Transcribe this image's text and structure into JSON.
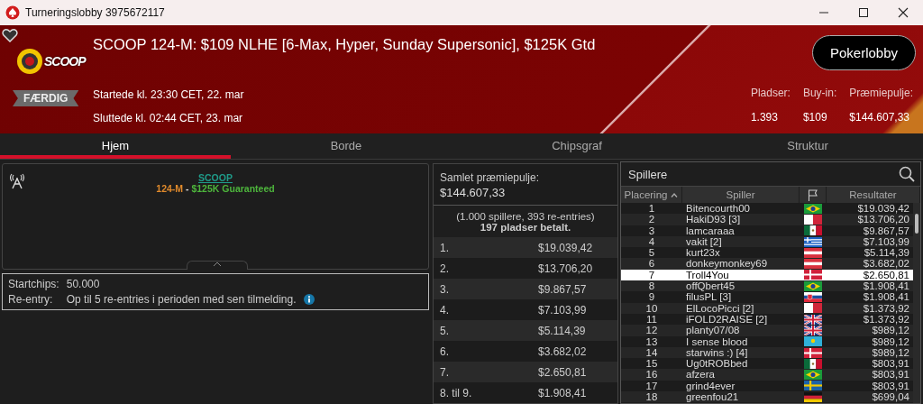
{
  "window": {
    "title": "Turneringslobby 3975672117"
  },
  "header": {
    "logo_text": "SCOOP",
    "status": "FÆRDIG",
    "title": "SCOOP 124-M: $109 NLHE [6-Max, Hyper, Sunday Supersonic], $125K Gtd",
    "started": "Startede kl. 23:30 CET, 22. mar",
    "ended": "Sluttede kl. 02:44 CET, 23. mar",
    "lobby_button": "Pokerlobby",
    "stats": [
      {
        "label": "Pladser:",
        "value": "1.393"
      },
      {
        "label": "Buy-in:",
        "value": "$109"
      },
      {
        "label": "Præmiepulje:",
        "value": "$144.607,33"
      }
    ]
  },
  "tabs": [
    {
      "label": "Hjem",
      "selected": true
    },
    {
      "label": "Borde",
      "selected": false
    },
    {
      "label": "Chipsgraf",
      "selected": false
    },
    {
      "label": "Struktur",
      "selected": false
    }
  ],
  "info": {
    "series_link": "SCOOP",
    "event_code": "124-M",
    "separator": "-",
    "guarantee": "$125K Guaranteed",
    "details": [
      {
        "label": "Startchips:",
        "value": "50.000",
        "info": false
      },
      {
        "label": "Re-entry:",
        "value": "Op til 5 re-entries i perioden med sen tilmelding.",
        "info": true
      }
    ]
  },
  "prizes": {
    "label": "Samlet præmiepulje:",
    "total": "$144.607,33",
    "entries": "(1.000 spillere, 393 re-entries)",
    "paid": "197 pladser betalt.",
    "rows": [
      {
        "place": "1.",
        "amount": "$19.039,42"
      },
      {
        "place": "2.",
        "amount": "$13.706,20"
      },
      {
        "place": "3.",
        "amount": "$9.867,57"
      },
      {
        "place": "4.",
        "amount": "$7.103,99"
      },
      {
        "place": "5.",
        "amount": "$5.114,39"
      },
      {
        "place": "6.",
        "amount": "$3.682,02"
      },
      {
        "place": "7.",
        "amount": "$2.650,81"
      },
      {
        "place": "8. til 9.",
        "amount": "$1.908,41"
      }
    ]
  },
  "players": {
    "title": "Spillere",
    "columns": [
      "Placering",
      "Spiller",
      "Resultater"
    ],
    "rows": [
      {
        "rank": "1",
        "name": "Bitencourth00",
        "kind": "br",
        "result": "$19.039,42",
        "selected": false
      },
      {
        "rank": "2",
        "name": "HakiD93 [3]",
        "kind": "mt",
        "result": "$13.706,20",
        "selected": false
      },
      {
        "rank": "3",
        "name": "lamcaraaa",
        "kind": "mx",
        "result": "$9.867,57",
        "selected": false
      },
      {
        "rank": "4",
        "name": "vakit [2]",
        "kind": "gr",
        "result": "$7.103,99",
        "selected": false
      },
      {
        "rank": "5",
        "name": "kurt23x",
        "kind": "at",
        "result": "$5.114,39",
        "selected": false
      },
      {
        "rank": "6",
        "name": "donkeymonkey69",
        "kind": "at",
        "result": "$3.682,02",
        "selected": false
      },
      {
        "rank": "7",
        "name": "Troll4You",
        "kind": "dk",
        "result": "$2.650,81",
        "selected": true
      },
      {
        "rank": "8",
        "name": "offQbert45",
        "kind": "br",
        "result": "$1.908,41",
        "selected": false
      },
      {
        "rank": "9",
        "name": "filusPL [3]",
        "kind": "sk",
        "result": "$1.908,41",
        "selected": false
      },
      {
        "rank": "10",
        "name": "ElLocoPicci [2]",
        "kind": "mt",
        "result": "$1.373,92",
        "selected": false
      },
      {
        "rank": "11",
        "name": "iFOLD2RAISE [2]",
        "kind": "gb",
        "result": "$1.373,92",
        "selected": false
      },
      {
        "rank": "12",
        "name": "planty07/08",
        "kind": "gb",
        "result": "$989,12",
        "selected": false
      },
      {
        "rank": "13",
        "name": "I sense blood",
        "kind": "kz",
        "result": "$989,12",
        "selected": false
      },
      {
        "rank": "14",
        "name": "starwins :) [4]",
        "kind": "dk",
        "result": "$989,12",
        "selected": false
      },
      {
        "rank": "15",
        "name": "Ug0tROBbed",
        "kind": "mx",
        "result": "$803,91",
        "selected": false
      },
      {
        "rank": "16",
        "name": "afzera",
        "kind": "br",
        "result": "$803,91",
        "selected": false
      },
      {
        "rank": "17",
        "name": "grind4ever",
        "kind": "se",
        "result": "$803,91",
        "selected": false
      },
      {
        "rank": "18",
        "name": "greenfou21",
        "kind": "de",
        "result": "$699,04",
        "selected": false
      }
    ]
  }
}
